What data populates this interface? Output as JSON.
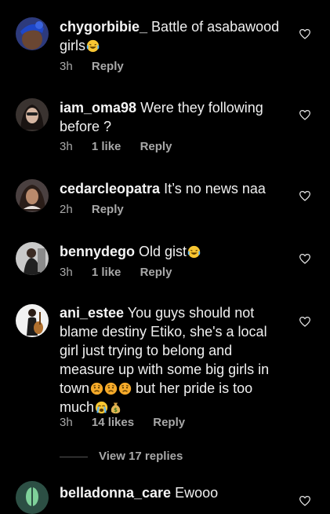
{
  "comments": [
    {
      "username": "chygorbibie_",
      "text": "Battle of asabawood girls",
      "time": "3h",
      "likes": "",
      "reply": "Reply"
    },
    {
      "username": "iam_oma98",
      "text": "Were they following before ?",
      "time": "3h",
      "likes": "1 like",
      "reply": "Reply"
    },
    {
      "username": "cedarcleopatra",
      "text": "It’s no news naa",
      "time": "2h",
      "likes": "",
      "reply": "Reply"
    },
    {
      "username": "bennydego",
      "text": "Old gist",
      "time": "3h",
      "likes": "1 like",
      "reply": "Reply"
    },
    {
      "username": "ani_estee",
      "text_lines": [
        "You guys should not",
        "blame destiny Etiko, she's a local",
        "girl just trying to belong and",
        "measure up with some big girls in",
        "town",
        "but her pride is too",
        "much"
      ],
      "time": "3h",
      "likes": "14 likes",
      "reply": "Reply"
    },
    {
      "username": "belladonna_care",
      "text": "Ewooo"
    }
  ],
  "view_replies": "View 17 replies",
  "icons": {
    "heart": "heart-outline-icon",
    "emoji_laugh": "tears-of-joy-emoji",
    "emoji_sad": "sad-face-emoji",
    "emoji_cry": "crying-face-emoji",
    "emoji_money": "money-bag-emoji"
  },
  "colors": {
    "background": "#000000",
    "text": "#f2f2f2",
    "secondary": "#a8a8a8"
  }
}
